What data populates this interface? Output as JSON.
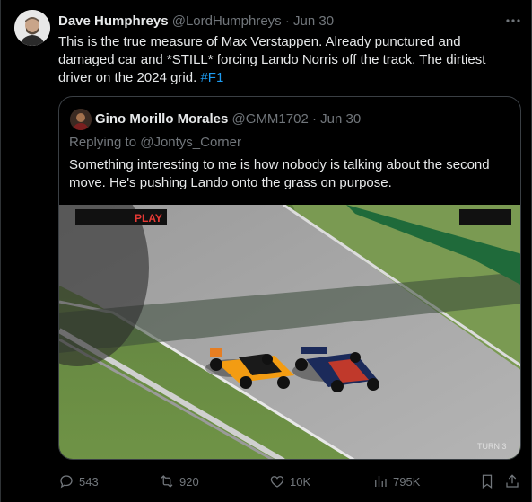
{
  "tweet": {
    "author_name": "Dave Humphreys",
    "author_handle": "@LordHumphreys",
    "separator": "·",
    "date": "Jun 30",
    "text_before": "This is the true measure of Max Verstappen. Already punctured and damaged car and *STILL* forcing Lando Norris off the track. The dirtiest driver on the 2024 grid. ",
    "hashtag": "#F1"
  },
  "quote": {
    "author_name": "Gino Morillo Morales",
    "author_handle": "@GMM1702",
    "separator": "·",
    "date": "Jun 30",
    "replying_to": "Replying to @Jontys_Corner",
    "text": "Something interesting to me is how nobody is talking about the second move. He's pushing Lando onto the grass on purpose.",
    "video_overlay_text": "PLAY",
    "video_corner_text": "TURN 3"
  },
  "actions": {
    "replies": "543",
    "retweets": "920",
    "likes": "10K",
    "views": "795K"
  },
  "icons": [
    "more-icon",
    "reply-icon",
    "retweet-icon",
    "like-icon",
    "views-icon",
    "bookmark-icon",
    "share-icon"
  ],
  "colors": {
    "background": "#000000",
    "text": "#e7e9ea",
    "muted": "#71767b",
    "link": "#1d9bf0"
  }
}
